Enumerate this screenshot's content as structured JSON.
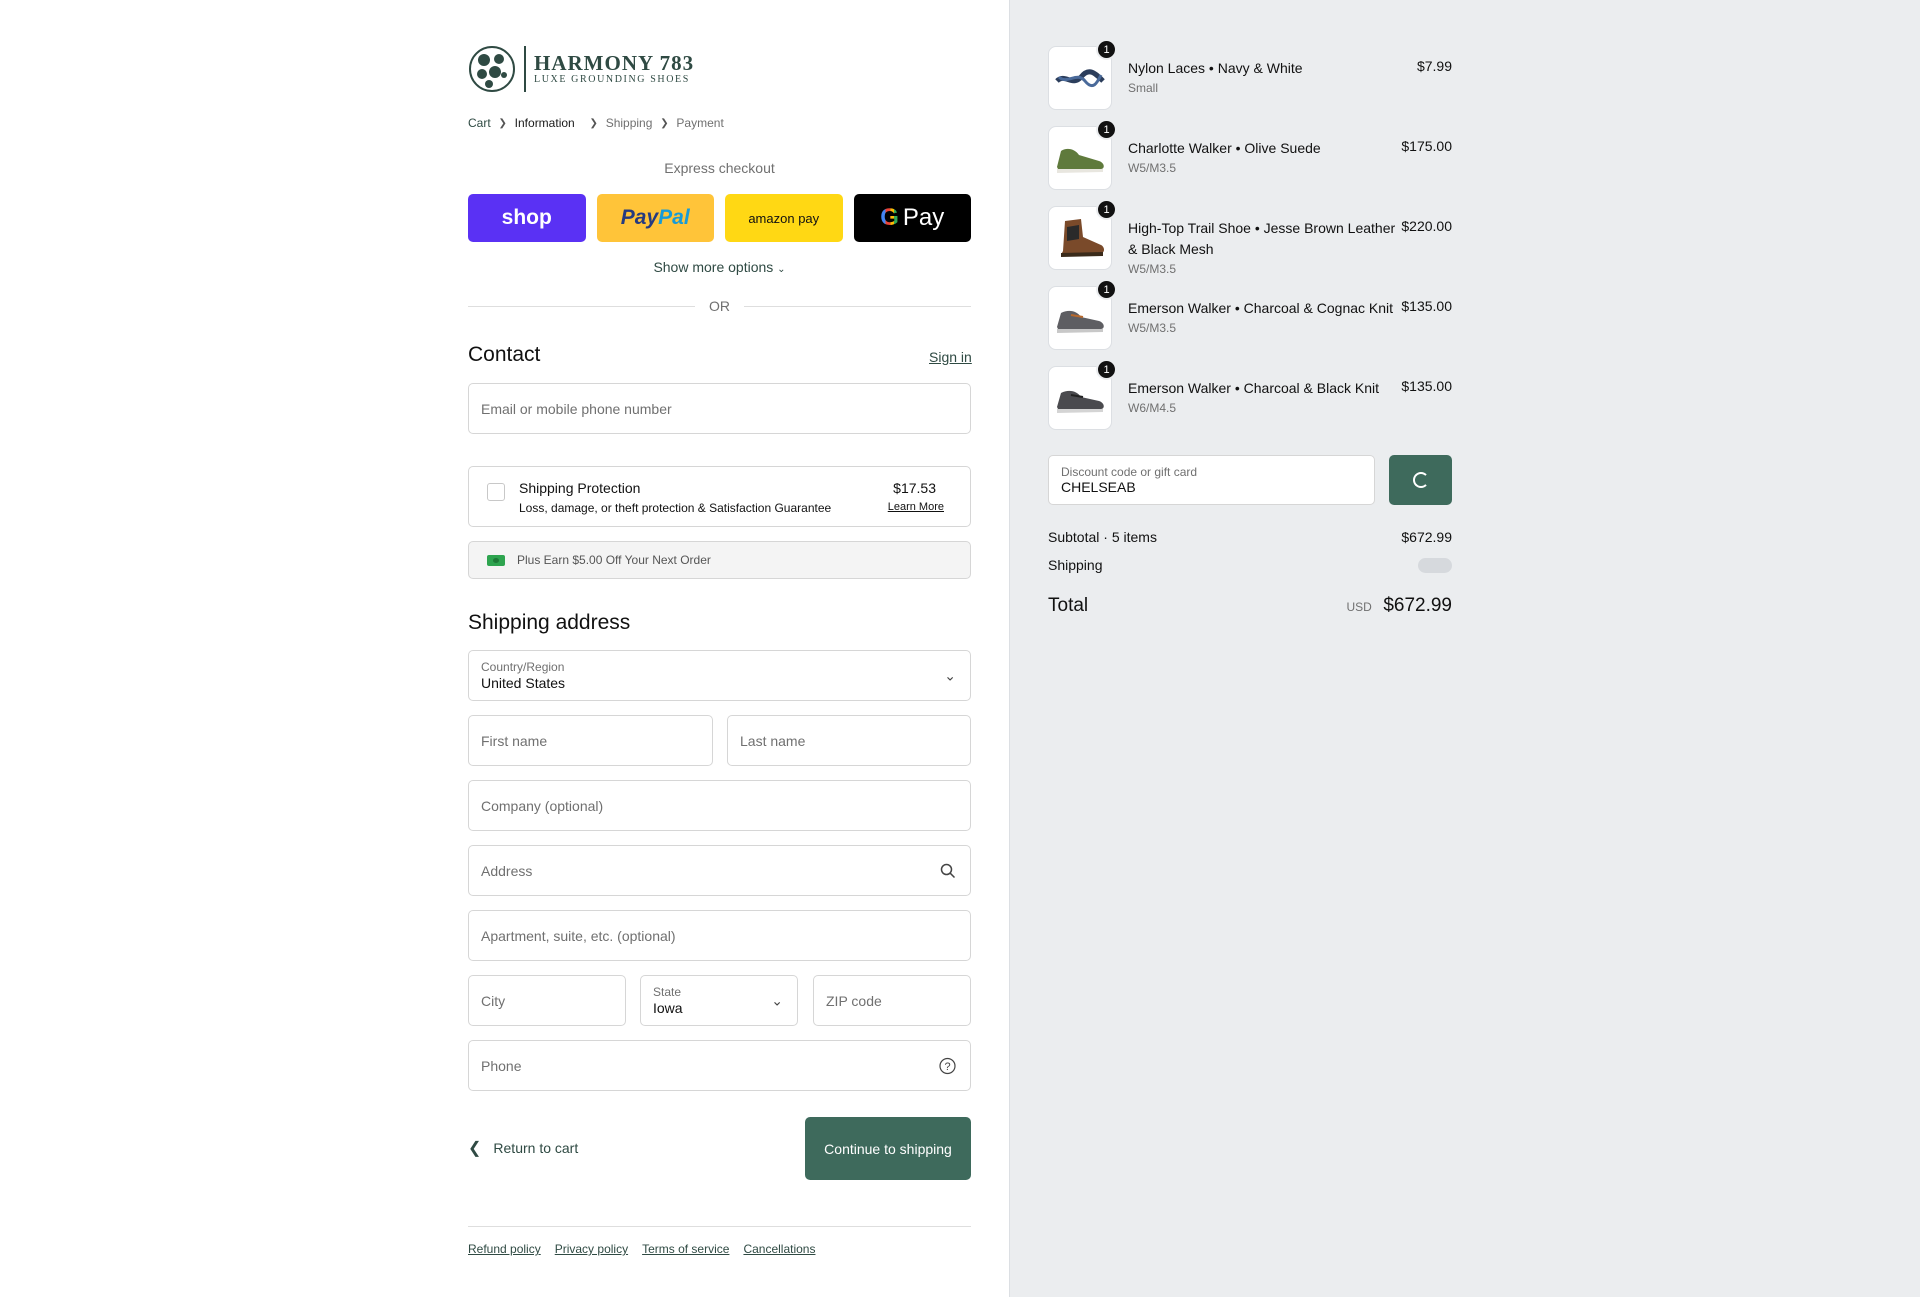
{
  "brand": {
    "name": "HARMONY 783",
    "tagline": "LUXE GROUNDING SHOES"
  },
  "breadcrumb": [
    "Cart",
    "Information",
    "Shipping",
    "Payment"
  ],
  "express": {
    "title": "Express checkout",
    "buttons": {
      "shop": "shop",
      "paypal_1": "Pay",
      "paypal_2": "Pal",
      "amazon": "amazon pay",
      "gpay": "Pay"
    },
    "more": "Show more options",
    "or": "OR"
  },
  "contact": {
    "title": "Contact",
    "signin": "Sign in",
    "email_placeholder": "Email or mobile phone number"
  },
  "protection": {
    "title": "Shipping Protection",
    "desc": "Loss, damage, or theft protection & Satisfaction Guarantee",
    "price": "$17.53",
    "learn": "Learn More"
  },
  "earn": "Plus Earn $5.00 Off Your Next Order",
  "shipping": {
    "title": "Shipping address",
    "country_label": "Country/Region",
    "country": "United States",
    "first": "First name",
    "last": "Last name",
    "company": "Company (optional)",
    "address": "Address",
    "apartment": "Apartment, suite, etc. (optional)",
    "city": "City",
    "state_label": "State",
    "state": "Iowa",
    "zip": "ZIP code",
    "phone": "Phone"
  },
  "actions": {
    "return": "Return to cart",
    "continue": "Continue to shipping"
  },
  "footer": [
    "Refund policy",
    "Privacy policy",
    "Terms of service",
    "Cancellations"
  ],
  "cart": {
    "items": [
      {
        "name": "Nylon Laces • Navy & White",
        "variant": "Small",
        "price": "$7.99",
        "qty": "1"
      },
      {
        "name": "Charlotte Walker • Olive Suede",
        "variant": "W5/M3.5",
        "price": "$175.00",
        "qty": "1"
      },
      {
        "name": "High-Top Trail Shoe • Jesse Brown Leather & Black Mesh",
        "variant": "W5/M3.5",
        "price": "$220.00",
        "qty": "1"
      },
      {
        "name": "Emerson Walker • Charcoal & Cognac Knit",
        "variant": "W5/M3.5",
        "price": "$135.00",
        "qty": "1"
      },
      {
        "name": "Emerson Walker • Charcoal & Black Knit",
        "variant": "W6/M4.5",
        "price": "$135.00",
        "qty": "1"
      }
    ],
    "discount_label": "Discount code or gift card",
    "discount_value": "CHELSEAB",
    "subtotal_label": "Subtotal · 5 items",
    "subtotal": "$672.99",
    "shipping_label": "Shipping",
    "total_label": "Total",
    "currency": "USD",
    "total": "$672.99"
  },
  "colors": {
    "accent": "#3e6a5c",
    "shop": "#5a31f4",
    "paypal": "#ffc439",
    "amazon": "#ffd814"
  }
}
